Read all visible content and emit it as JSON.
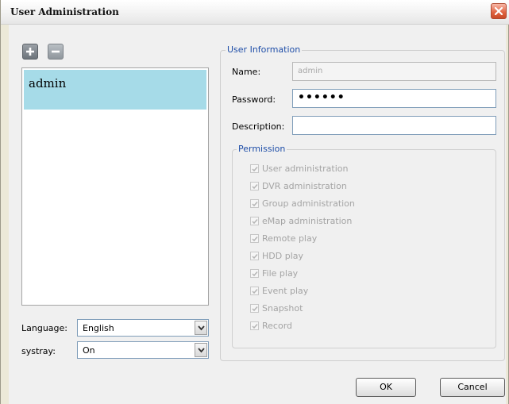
{
  "window": {
    "title": "User Administration"
  },
  "toolbar": {
    "add_icon": "plus-icon",
    "remove_icon": "minus-icon"
  },
  "users": [
    {
      "name": "admin",
      "selected": true
    }
  ],
  "settings": {
    "language_label": "Language:",
    "language_value": "English",
    "systray_label": "systray:",
    "systray_value": "On"
  },
  "user_info": {
    "legend": "User Information",
    "name_label": "Name:",
    "name_value": "admin",
    "password_label": "Password:",
    "password_value": "••••••",
    "description_label": "Description:",
    "description_value": ""
  },
  "permission": {
    "legend": "Permission",
    "items": [
      {
        "label": "User administration",
        "checked": true
      },
      {
        "label": "DVR administration",
        "checked": true
      },
      {
        "label": "Group administration",
        "checked": true
      },
      {
        "label": "eMap administration",
        "checked": true
      },
      {
        "label": "Remote play",
        "checked": true
      },
      {
        "label": "HDD play",
        "checked": true
      },
      {
        "label": "File play",
        "checked": true
      },
      {
        "label": "Event play",
        "checked": true
      },
      {
        "label": "Snapshot",
        "checked": true
      },
      {
        "label": "Record",
        "checked": true
      }
    ]
  },
  "buttons": {
    "ok": "OK",
    "cancel": "Cancel"
  },
  "colors": {
    "selection": "#a6dbe8",
    "legend_text": "#1f4ea8",
    "disabled_text": "#a4a4a4"
  }
}
